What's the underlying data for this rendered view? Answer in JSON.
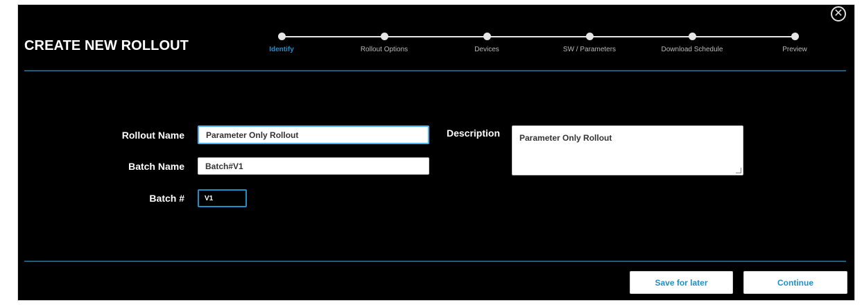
{
  "dialog": {
    "title": "CREATE NEW ROLLOUT",
    "close_icon": "close-circle-icon"
  },
  "stepper": {
    "steps": [
      {
        "label": "Identify",
        "active": true
      },
      {
        "label": "Rollout Options",
        "active": false
      },
      {
        "label": "Devices",
        "active": false
      },
      {
        "label": "SW / Parameters",
        "active": false
      },
      {
        "label": "Download Schedule",
        "active": false
      },
      {
        "label": "Preview",
        "active": false
      }
    ]
  },
  "form": {
    "rollout_name_label": "Rollout Name",
    "rollout_name_value": "Parameter Only Rollout",
    "batch_name_label": "Batch Name",
    "batch_name_value": "Batch#V1",
    "batch_number_label": "Batch #",
    "batch_number_value": "V1",
    "description_label": "Description",
    "description_value": "Parameter Only Rollout"
  },
  "footer": {
    "save_later_label": "Save for later",
    "continue_label": "Continue"
  },
  "colors": {
    "accent": "#1e8fc7",
    "background": "#000000",
    "divider": "#1b5e7b"
  }
}
